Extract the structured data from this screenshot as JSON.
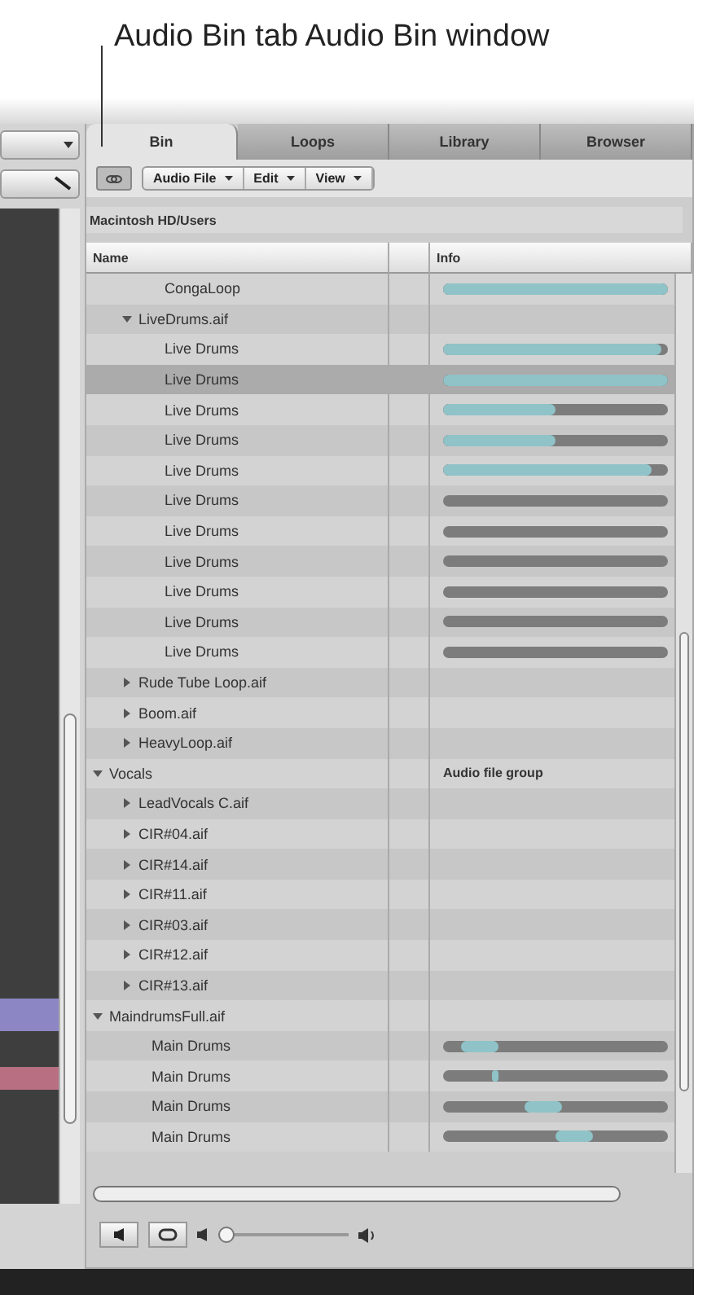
{
  "callout": {
    "text": "Audio Bin tab Audio Bin window"
  },
  "tabs": [
    {
      "label": "Bin",
      "selected": true
    },
    {
      "label": "Loops",
      "selected": false
    },
    {
      "label": "Library",
      "selected": false
    },
    {
      "label": "Browser",
      "selected": false
    }
  ],
  "toolbar": {
    "menus": [
      "Audio File",
      "Edit",
      "View"
    ]
  },
  "path": "Macintosh HD/Users",
  "columns": [
    "Name",
    "Info"
  ],
  "rows": [
    {
      "kind": "region",
      "name": "CongaLoop",
      "selected": false,
      "level": 1
    },
    {
      "kind": "file",
      "name": "LiveDrums.aif",
      "expanded": true,
      "children": [
        {
          "kind": "region",
          "name": "Live Drums",
          "selected": false,
          "level": 0.97
        },
        {
          "kind": "region",
          "name": "Live Drums",
          "selected": true,
          "level": 1
        },
        {
          "kind": "region",
          "name": "Live Drums",
          "selected": false,
          "level": 0.5
        },
        {
          "kind": "region",
          "name": "Live Drums",
          "selected": false,
          "level": 0.5
        },
        {
          "kind": "region",
          "name": "Live Drums",
          "selected": false,
          "level": 0.93
        },
        {
          "kind": "region",
          "name": "Live Drums",
          "selected": false
        },
        {
          "kind": "region",
          "name": "Live Drums",
          "selected": false
        },
        {
          "kind": "region",
          "name": "Live Drums",
          "selected": false
        },
        {
          "kind": "region",
          "name": "Live Drums",
          "selected": false
        },
        {
          "kind": "region",
          "name": "Live Drums",
          "selected": false
        },
        {
          "kind": "region",
          "name": "Live Drums",
          "selected": false
        }
      ]
    },
    {
      "kind": "file",
      "name": "Rude Tube Loop.aif",
      "expanded": false
    },
    {
      "kind": "file",
      "name": "Boom.aif",
      "expanded": false
    },
    {
      "kind": "file",
      "name": "HeavyLoop.aif",
      "expanded": false
    },
    {
      "kind": "group",
      "name": "Vocals",
      "info": "Audio file group",
      "expanded": true,
      "children": [
        {
          "kind": "file",
          "name": "LeadVocals C.aif",
          "expanded": false
        },
        {
          "kind": "file",
          "name": "CIR#04.aif",
          "expanded": false
        },
        {
          "kind": "file",
          "name": "CIR#14.aif",
          "expanded": false
        },
        {
          "kind": "file",
          "name": "CIR#11.aif",
          "expanded": false
        },
        {
          "kind": "file",
          "name": "CIR#03.aif",
          "expanded": false
        },
        {
          "kind": "file",
          "name": "CIR#12.aif",
          "expanded": false
        },
        {
          "kind": "file",
          "name": "CIR#13.aif",
          "expanded": false
        }
      ]
    },
    {
      "kind": "group",
      "name": "MaindrumsFull.aif",
      "expanded": true,
      "children": [
        {
          "kind": "segment",
          "name": "Main Drums",
          "selected": false
        },
        {
          "kind": "segment",
          "name": "Main Drums",
          "selected": false
        },
        {
          "kind": "segment",
          "name": "Main Drums",
          "selected": false
        },
        {
          "kind": "segment",
          "name": "Main Drums",
          "selected": false
        }
      ]
    }
  ],
  "volume": {
    "level": 0.05
  }
}
